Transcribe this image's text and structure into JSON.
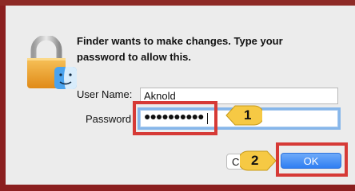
{
  "dialog": {
    "message": "Finder wants to make changes. Type your password to allow this.",
    "username_label": "User Name:",
    "username_value": "Aknold",
    "password_label": "Password",
    "password_mask": "●●●●●●●●●●",
    "cancel_label": "Ca",
    "ok_label": "OK"
  },
  "annotations": {
    "step1": "1",
    "step2": "2"
  },
  "colors": {
    "highlight": "#d63a36",
    "badge_fill": "#f6c944",
    "accent": "#2f7ef2"
  },
  "icons": {
    "lock": "lock-icon",
    "finder": "finder-icon"
  }
}
